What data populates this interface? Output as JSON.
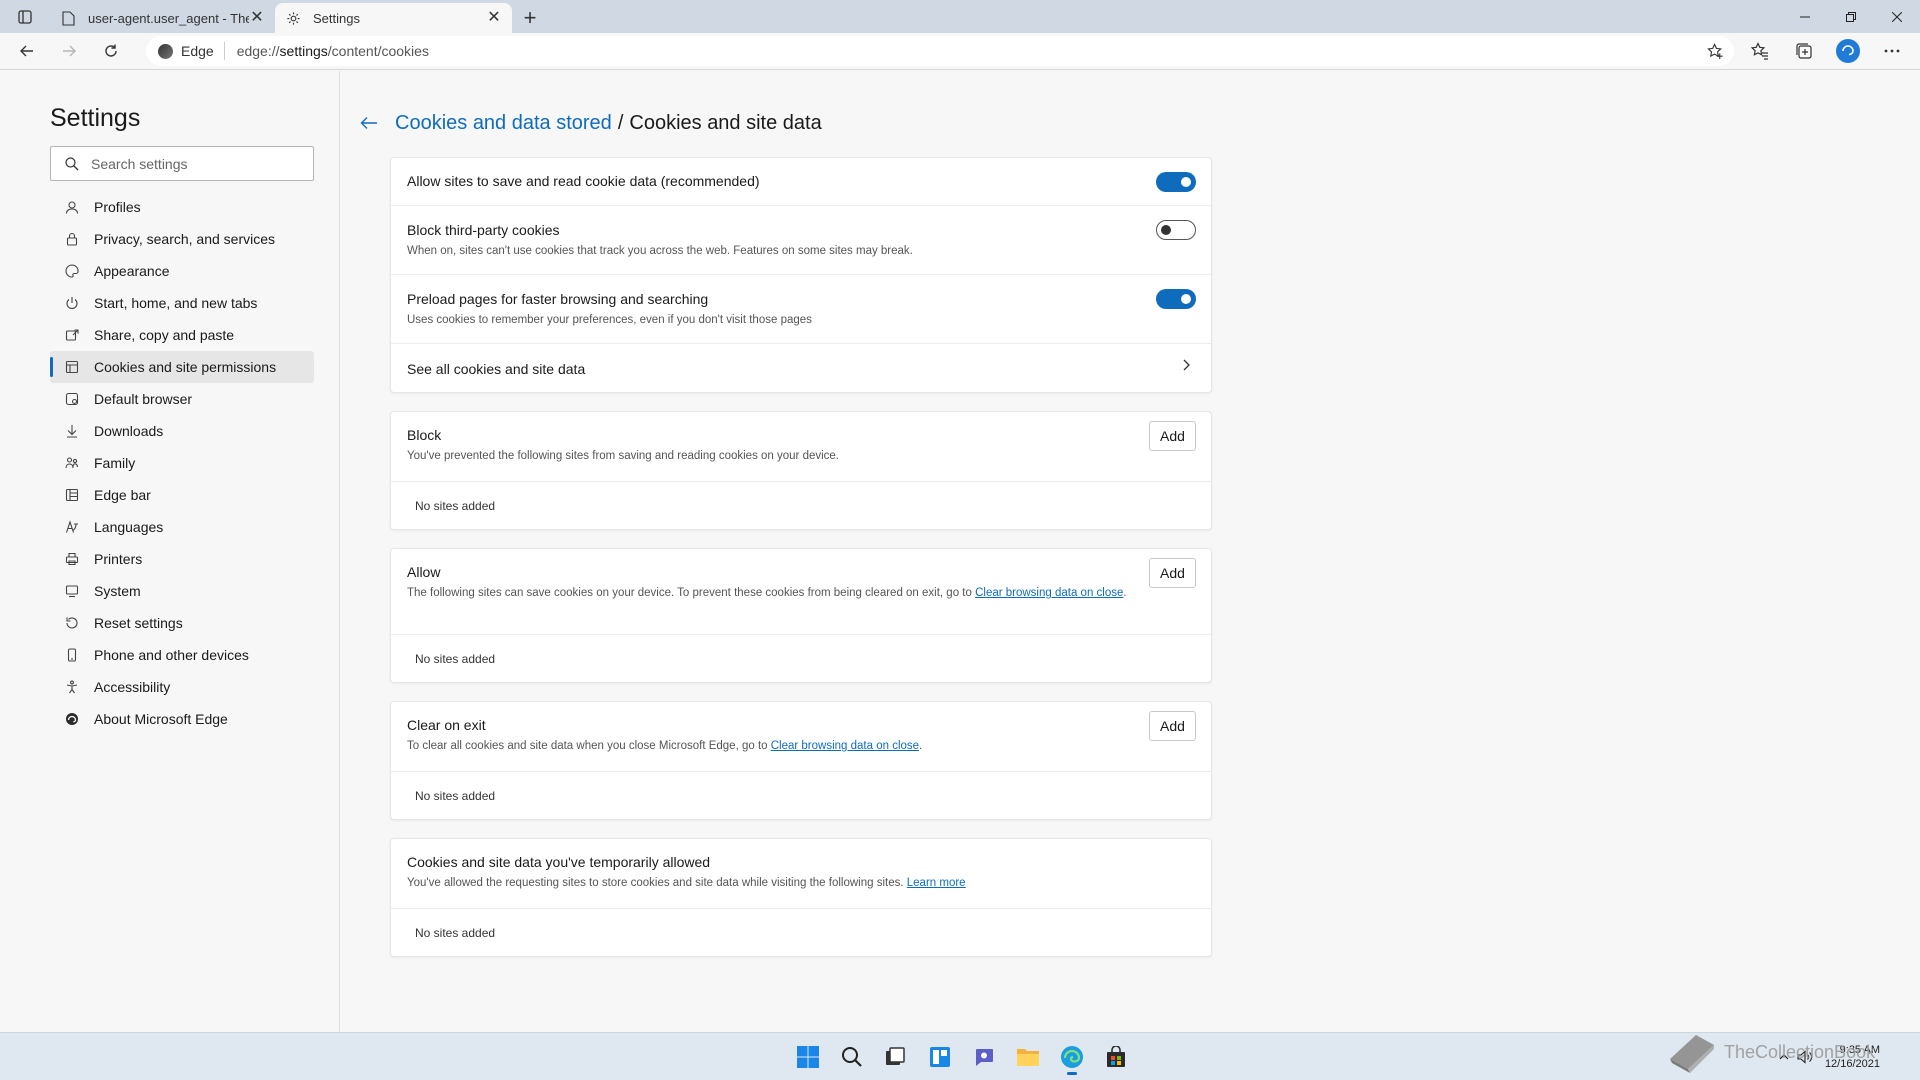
{
  "tabs": [
    {
      "title": "user-agent.user_agent - The Coll",
      "icon": "file-icon",
      "active": false
    },
    {
      "title": "Settings",
      "icon": "gear-icon",
      "active": true
    }
  ],
  "toolbar": {
    "address_badge": "Edge",
    "address_prefix": "edge://",
    "address_path": "settings",
    "address_rest": "/content/cookies"
  },
  "sidebar": {
    "title": "Settings",
    "search_placeholder": "Search settings",
    "items": [
      {
        "label": "Profiles",
        "icon": "profile-icon"
      },
      {
        "label": "Privacy, search, and services",
        "icon": "lock-icon"
      },
      {
        "label": "Appearance",
        "icon": "appearance-icon"
      },
      {
        "label": "Start, home, and new tabs",
        "icon": "power-icon"
      },
      {
        "label": "Share, copy and paste",
        "icon": "share-icon"
      },
      {
        "label": "Cookies and site permissions",
        "icon": "cookies-icon",
        "active": true
      },
      {
        "label": "Default browser",
        "icon": "browser-icon"
      },
      {
        "label": "Downloads",
        "icon": "download-icon"
      },
      {
        "label": "Family",
        "icon": "family-icon"
      },
      {
        "label": "Edge bar",
        "icon": "edge-bar-icon"
      },
      {
        "label": "Languages",
        "icon": "languages-icon"
      },
      {
        "label": "Printers",
        "icon": "printer-icon"
      },
      {
        "label": "System",
        "icon": "system-icon"
      },
      {
        "label": "Reset settings",
        "icon": "reset-icon"
      },
      {
        "label": "Phone and other devices",
        "icon": "phone-icon"
      },
      {
        "label": "Accessibility",
        "icon": "accessibility-icon"
      },
      {
        "label": "About Microsoft Edge",
        "icon": "edge-icon"
      }
    ]
  },
  "breadcrumb": {
    "parent": "Cookies and data stored",
    "separator": "/",
    "current": "Cookies and site data"
  },
  "cookie_settings": {
    "allow": {
      "title": "Allow sites to save and read cookie data (recommended)",
      "enabled": true
    },
    "block_third_party": {
      "title": "Block third-party cookies",
      "desc": "When on, sites can't use cookies that track you across the web. Features on some sites may break.",
      "enabled": false
    },
    "preload": {
      "title": "Preload pages for faster browsing and searching",
      "desc": "Uses cookies to remember your preferences, even if you don't visit those pages",
      "enabled": true
    },
    "see_all": {
      "title": "See all cookies and site data"
    }
  },
  "sections": {
    "block": {
      "title": "Block",
      "desc": "You've prevented the following sites from saving and reading cookies on your device.",
      "add_label": "Add",
      "empty": "No sites added"
    },
    "allow": {
      "title": "Allow",
      "desc": "The following sites can save cookies on your device. To prevent these cookies from being cleared on exit, go to ",
      "link": "Clear browsing data on close",
      "desc_end": ".",
      "add_label": "Add",
      "empty": "No sites added"
    },
    "clear_on_exit": {
      "title": "Clear on exit",
      "desc": "To clear all cookies and site data when you close Microsoft Edge, go to ",
      "link": "Clear browsing data on close",
      "desc_end": ".",
      "add_label": "Add",
      "empty": "No sites added"
    },
    "temporarily_allowed": {
      "title": "Cookies and site data you've temporarily allowed",
      "desc": "You've allowed the requesting sites to store cookies and site data while visiting the following sites. ",
      "link": "Learn more",
      "empty": "No sites added"
    }
  },
  "taskbar": {
    "time": "9:35 AM",
    "date": "12/16/2021",
    "watermark": "TheCollectionBook",
    "apps": [
      "start-icon",
      "search-icon",
      "task-view-icon",
      "widgets-icon",
      "chat-icon",
      "file-explorer-icon",
      "edge-icon",
      "store-icon"
    ]
  },
  "colors": {
    "accent": "#0f6cbd",
    "tabstrip": "#cfd8e3",
    "taskbar": "#dfe7f0"
  }
}
